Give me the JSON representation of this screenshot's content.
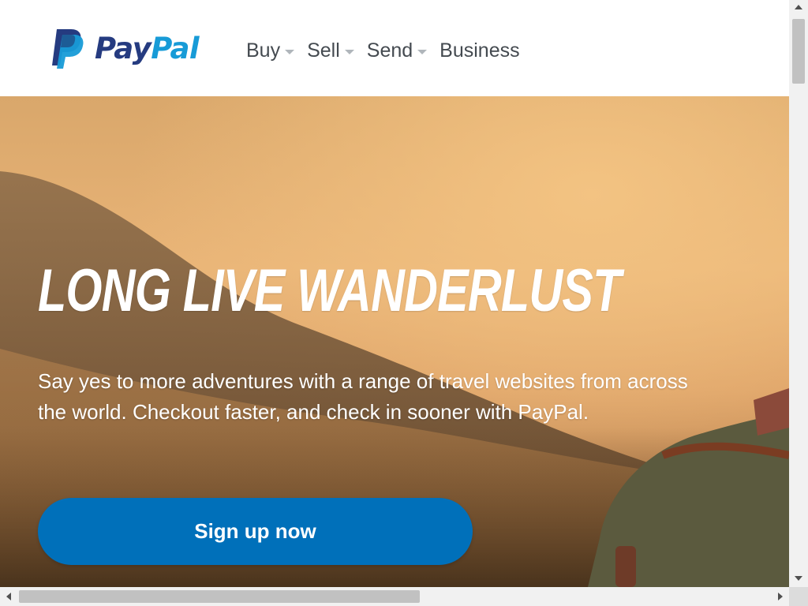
{
  "brand": {
    "name_part1": "Pay",
    "name_part2": "Pal",
    "colors": {
      "dark_blue": "#253b80",
      "light_blue": "#179bd7",
      "button_blue": "#0070ba"
    }
  },
  "nav": {
    "items": [
      {
        "label": "Buy",
        "has_dropdown": true
      },
      {
        "label": "Sell",
        "has_dropdown": true
      },
      {
        "label": "Send",
        "has_dropdown": true
      },
      {
        "label": "Business",
        "has_dropdown": false
      }
    ]
  },
  "hero": {
    "title": "LONG LIVE WANDERLUST",
    "body": "Say yes to more adventures with a range of travel websites from across the world. Checkout faster, and check in sooner with PayPal.",
    "cta_label": "Sign up now"
  },
  "icons": {
    "logo": "paypal-p-logo-icon",
    "dropdown": "chevron-down-icon"
  }
}
